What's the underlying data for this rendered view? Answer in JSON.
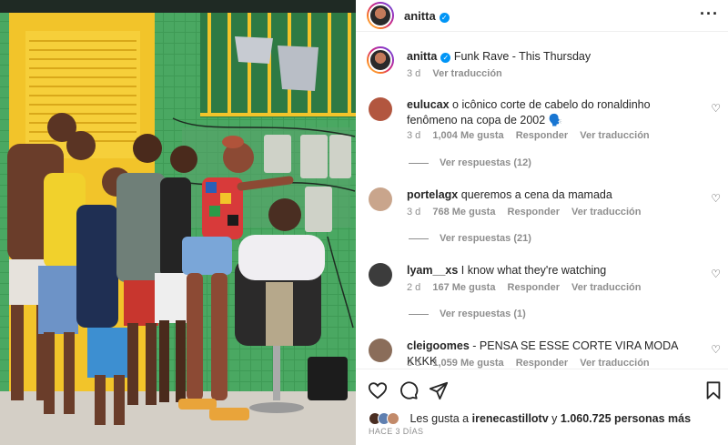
{
  "post": {
    "author": "anitta",
    "verified": true,
    "more_icon": "more-horizontal-icon"
  },
  "caption": {
    "author": "anitta",
    "text": "Funk Rave - This Thursday",
    "time": "3 d",
    "translate": "Ver traducción"
  },
  "comments": [
    {
      "user": "eulucax",
      "text": "o icônico corte de cabelo do ronaldinho fenômeno na copa de 2002 🗣️",
      "time": "3 d",
      "likes": "1,004 Me gusta",
      "reply": "Responder",
      "translate": "Ver traducción",
      "replies": "Ver respuestas (12)",
      "avatar_color": "#b2563f"
    },
    {
      "user": "portelagx",
      "text": "queremos a cena da mamada",
      "time": "3 d",
      "likes": "768 Me gusta",
      "reply": "Responder",
      "translate": "Ver traducción",
      "replies": "Ver respuestas (21)",
      "avatar_color": "#c9a58c"
    },
    {
      "user": "lyam__xs",
      "text": "I know what they're watching",
      "time": "2 d",
      "likes": "167 Me gusta",
      "reply": "Responder",
      "translate": "Ver traducción",
      "replies": "Ver respuestas (1)",
      "avatar_color": "#3c3c3c"
    },
    {
      "user": "cleigoomes",
      "text": "- PENSA SE ESSE CORTE VIRA MODA KKKK",
      "time": "3 d",
      "likes": "1,059 Me gusta",
      "reply": "Responder",
      "translate": "Ver traducción",
      "replies": "",
      "avatar_color": "#8a6d5a"
    }
  ],
  "actions": {
    "like_icon": "heart-icon",
    "comment_icon": "comment-icon",
    "share_icon": "send-icon",
    "save_icon": "bookmark-icon"
  },
  "likes": {
    "prefix": "Les gusta a",
    "user": "irenecastillotv",
    "joiner": "y",
    "others": "1.060.725 personas más"
  },
  "posted": "HACE 3 DÍAS",
  "colors": {
    "verified": "#0095f6",
    "muted": "#8e8e8e",
    "text": "#262626"
  }
}
